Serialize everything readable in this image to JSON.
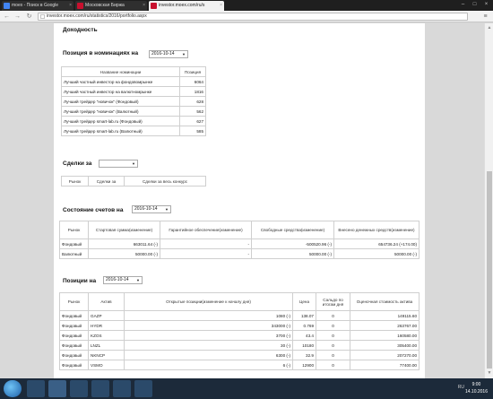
{
  "browser": {
    "tabs": [
      {
        "title": "moex - Поиск в Google",
        "favicon_color": "#4285f4"
      },
      {
        "title": "Московская Биржа",
        "favicon_color": "#c8102e"
      },
      {
        "title": "investor.moex.com/ru/s",
        "favicon_color": "#c8102e"
      }
    ],
    "url": "investor.moex.com/ru/statistics/2016/portfolio.aspx"
  },
  "page": {
    "section_title": "Доходность",
    "nominations": {
      "title": "Позиция в номинациях на",
      "date": "2016-10-14",
      "headers": [
        "Название номинации",
        "Позиция"
      ],
      "rows": [
        [
          "Лучший частный инвестор на фондовомрынке",
          "6064"
        ],
        [
          "Лучший частный инвестор на валютномрынке",
          "1816"
        ],
        [
          "Лучший трейдер \"новичок\" (Фондовый)",
          "628"
        ],
        [
          "Лучший трейдер \"новичок\" (Валютный)",
          "562"
        ],
        [
          "Лучший трейдер smart-lab.ru (Фондовый)",
          "627"
        ],
        [
          "Лучший трейдер smart-lab.ru (Валютный)",
          "585"
        ]
      ]
    },
    "deals": {
      "title": "Сделки за",
      "value": "",
      "headers": [
        "Рынок",
        "Сделки за",
        "Сделки за весь конкурс"
      ]
    },
    "accounts": {
      "title": "Состояние счетов на",
      "date": "2016-10-14",
      "headers": [
        "Рынок",
        "Стартовая сумма(изменение)",
        "Гарантийное обеспечение(изменение)",
        "Свободные средства(изменение)",
        "Внесено денежных средств(изменение)"
      ],
      "rows": [
        [
          "Фондовый",
          "663011.64 (-)",
          "-",
          "-500520.96 (-)",
          "654736.24 (+174.00)"
        ],
        [
          "Валютный",
          "50000.00 (-)",
          "-",
          "50000.00 (-)",
          "50000.00 (-)"
        ]
      ]
    },
    "positions": {
      "title": "Позиции на",
      "date": "2016-10-14",
      "headers": [
        "Рынок",
        "Актив",
        "Открытые позиции(изменение к началу дня)",
        "Цена",
        "Сальдо по итогам дня",
        "Оценочная стоимость актива"
      ],
      "rows": [
        [
          "Фондовый",
          "GAZP",
          "1080 (-)",
          "138.07",
          "0",
          "149115.60"
        ],
        [
          "Фондовый",
          "HYDR",
          "343000 (-)",
          "0.769",
          "0",
          "263767.00"
        ],
        [
          "Фондовый",
          "KZOS",
          "3700 (-)",
          "43.4",
          "0",
          "160580.00"
        ],
        [
          "Фондовый",
          "LNZL",
          "30 (-)",
          "10180",
          "0",
          "305400.00"
        ],
        [
          "Фондовый",
          "NKNCP",
          "6300 (-)",
          "32.9",
          "0",
          "207270.00"
        ],
        [
          "Фондовый",
          "VSMO",
          "6 (-)",
          "12900",
          "0",
          "77400.00"
        ]
      ]
    }
  },
  "taskbar": {
    "time": "9:00",
    "date": "14.10.2016",
    "lang": "RU"
  }
}
